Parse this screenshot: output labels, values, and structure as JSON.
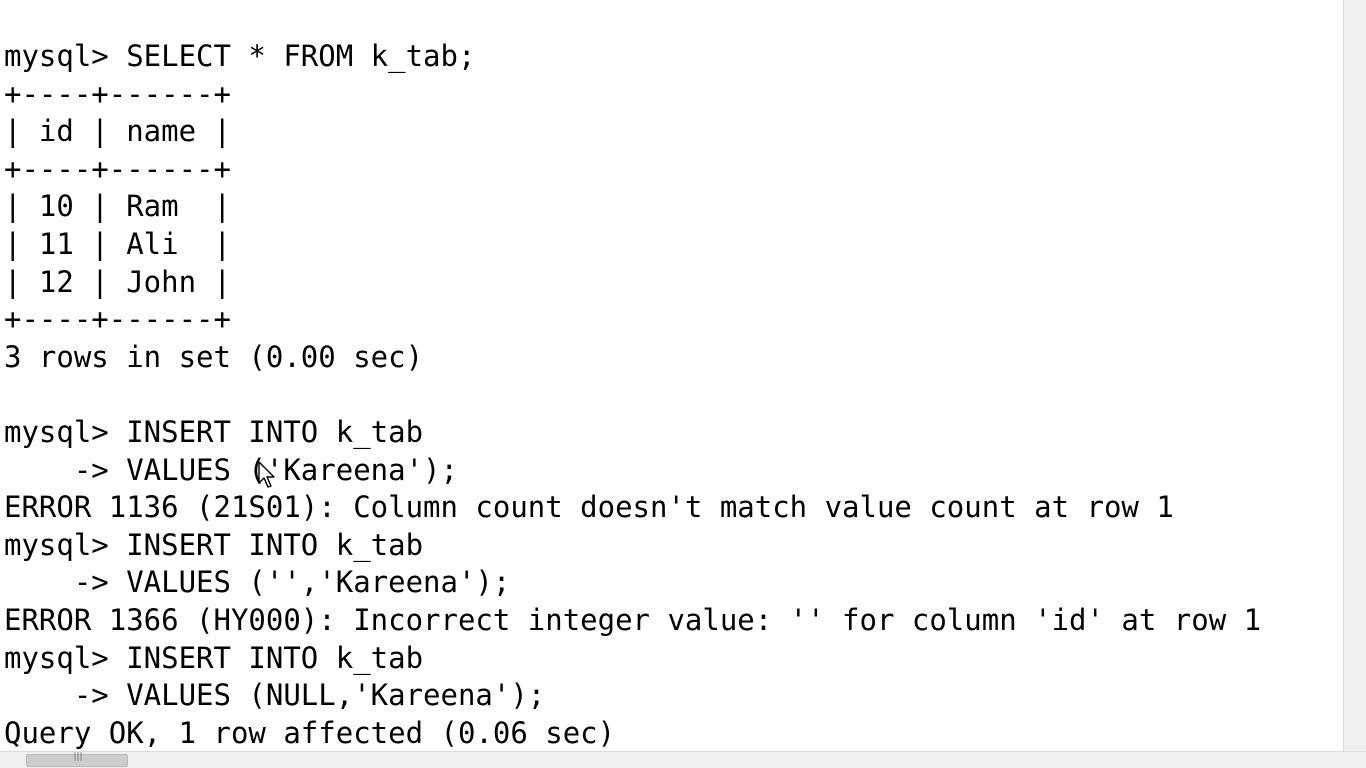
{
  "console": {
    "lines": [
      "mysql> SELECT * FROM k_tab;",
      "+----+------+",
      "| id | name |",
      "+----+------+",
      "| 10 | Ram  |",
      "| 11 | Ali  |",
      "| 12 | John |",
      "+----+------+",
      "3 rows in set (0.00 sec)",
      "",
      "mysql> INSERT INTO k_tab",
      "    -> VALUES ('Kareena');",
      "ERROR 1136 (21S01): Column count doesn't match value count at row 1",
      "mysql> INSERT INTO k_tab",
      "    -> VALUES ('','Kareena');",
      "ERROR 1366 (HY000): Incorrect integer value: '' for column 'id' at row 1",
      "mysql> INSERT INTO k_tab",
      "    -> VALUES (NULL,'Kareena');",
      "Query OK, 1 row affected (0.06 sec)"
    ]
  },
  "scrollbar": {
    "grip_glyph": "|||"
  },
  "icons": {
    "mouse_cursor": "arrow-pointer-icon"
  },
  "colors": {
    "background": "#ffffff",
    "text": "#000000",
    "scrollbar": "#f0f0f0"
  }
}
